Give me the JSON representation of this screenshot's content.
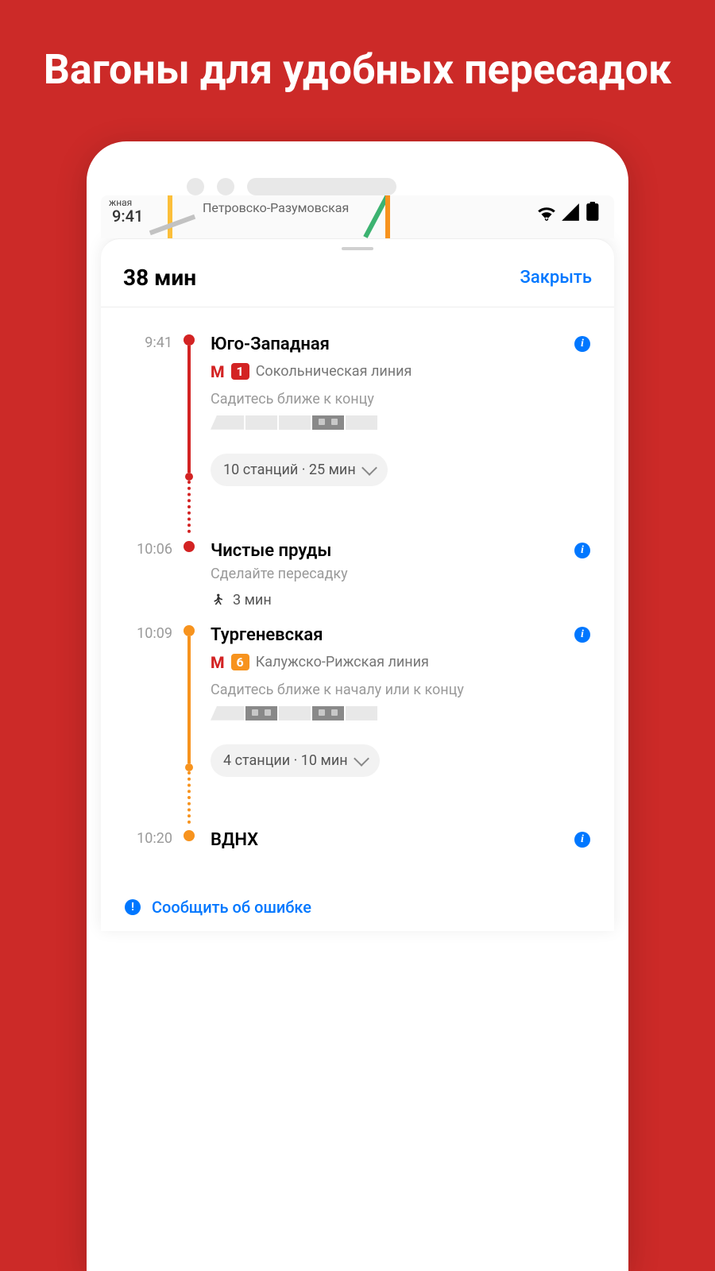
{
  "headline": "Вагоны для удобных пересадок",
  "map": {
    "partial_label": "жная",
    "station_label": "Петровско-Разумовская",
    "status_time": "9:41"
  },
  "sheet": {
    "total_time": "38 мин",
    "close": "Закрыть"
  },
  "steps": [
    {
      "time": "9:41",
      "station": "Юго-Западная",
      "line_number": "1",
      "line_name": "Сокольническая линия",
      "hint": "Садитесь ближе к концу",
      "expander": "10 станций · 25 мин",
      "color": "#d32323"
    },
    {
      "time": "10:06",
      "station": "Чистые пруды",
      "transfer_hint": "Сделайте пересадку",
      "walk_time": "3 мин"
    },
    {
      "time": "10:09",
      "station": "Тургеневская",
      "line_number": "6",
      "line_name": "Калужско-Рижская линия",
      "hint": "Садитесь ближе к началу или к концу",
      "expander": "4 станции · 10 мин",
      "color": "#f7931e"
    },
    {
      "time": "10:20",
      "station": "ВДНХ"
    }
  ],
  "report": "Сообщить об ошибке"
}
